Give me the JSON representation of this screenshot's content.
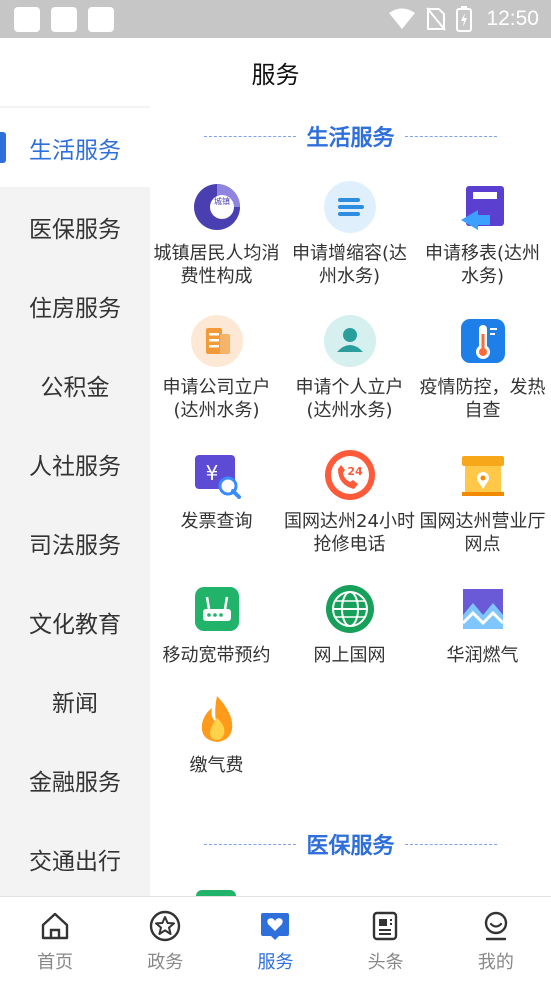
{
  "status_bar": {
    "time": "12:50"
  },
  "header": {
    "title": "服务"
  },
  "sidebar": {
    "items": [
      {
        "label": "生活服务",
        "active": true
      },
      {
        "label": "医保服务"
      },
      {
        "label": "住房服务"
      },
      {
        "label": "公积金"
      },
      {
        "label": "人社服务"
      },
      {
        "label": "司法服务"
      },
      {
        "label": "文化教育"
      },
      {
        "label": "新闻"
      },
      {
        "label": "金融服务"
      },
      {
        "label": "交通出行"
      }
    ]
  },
  "main": {
    "sections": [
      {
        "title": "生活服务",
        "services": [
          {
            "label": "城镇居民人均消费性构成",
            "icon": "pie-chart-icon",
            "badge_text": "城镇"
          },
          {
            "label": "申请增缩容(达州水务)",
            "icon": "equal-bars-icon"
          },
          {
            "label": "申请移表(达州水务)",
            "icon": "meter-transfer-icon"
          },
          {
            "label": "申请公司立户(达州水务)",
            "icon": "building-doc-icon"
          },
          {
            "label": "申请个人立户(达州水务)",
            "icon": "person-icon"
          },
          {
            "label": "疫情防控，发热自查",
            "icon": "thermometer-icon"
          },
          {
            "label": "发票查询",
            "icon": "invoice-search-icon"
          },
          {
            "label": "国网达州24小时抢修电话",
            "icon": "phone-24-icon",
            "badge_text": "24"
          },
          {
            "label": "国网达州营业厅网点",
            "icon": "store-location-icon"
          },
          {
            "label": "移动宽带预约",
            "icon": "router-icon"
          },
          {
            "label": "网上国网",
            "icon": "state-grid-logo-icon"
          },
          {
            "label": "华润燃气",
            "icon": "mountain-wave-icon"
          },
          {
            "label": "缴气费",
            "icon": "flame-icon"
          }
        ]
      },
      {
        "title": "医保服务",
        "services": []
      }
    ]
  },
  "bottom_nav": {
    "items": [
      {
        "label": "首页",
        "icon": "home-icon"
      },
      {
        "label": "政务",
        "icon": "star-circle-icon"
      },
      {
        "label": "服务",
        "icon": "heart-bubble-icon",
        "active": true
      },
      {
        "label": "头条",
        "icon": "news-icon"
      },
      {
        "label": "我的",
        "icon": "profile-icon"
      }
    ]
  },
  "colors": {
    "accent": "#2f6fdc",
    "sidebar_bg": "#f3f3f3",
    "status_bar": "#c6c6c6"
  }
}
